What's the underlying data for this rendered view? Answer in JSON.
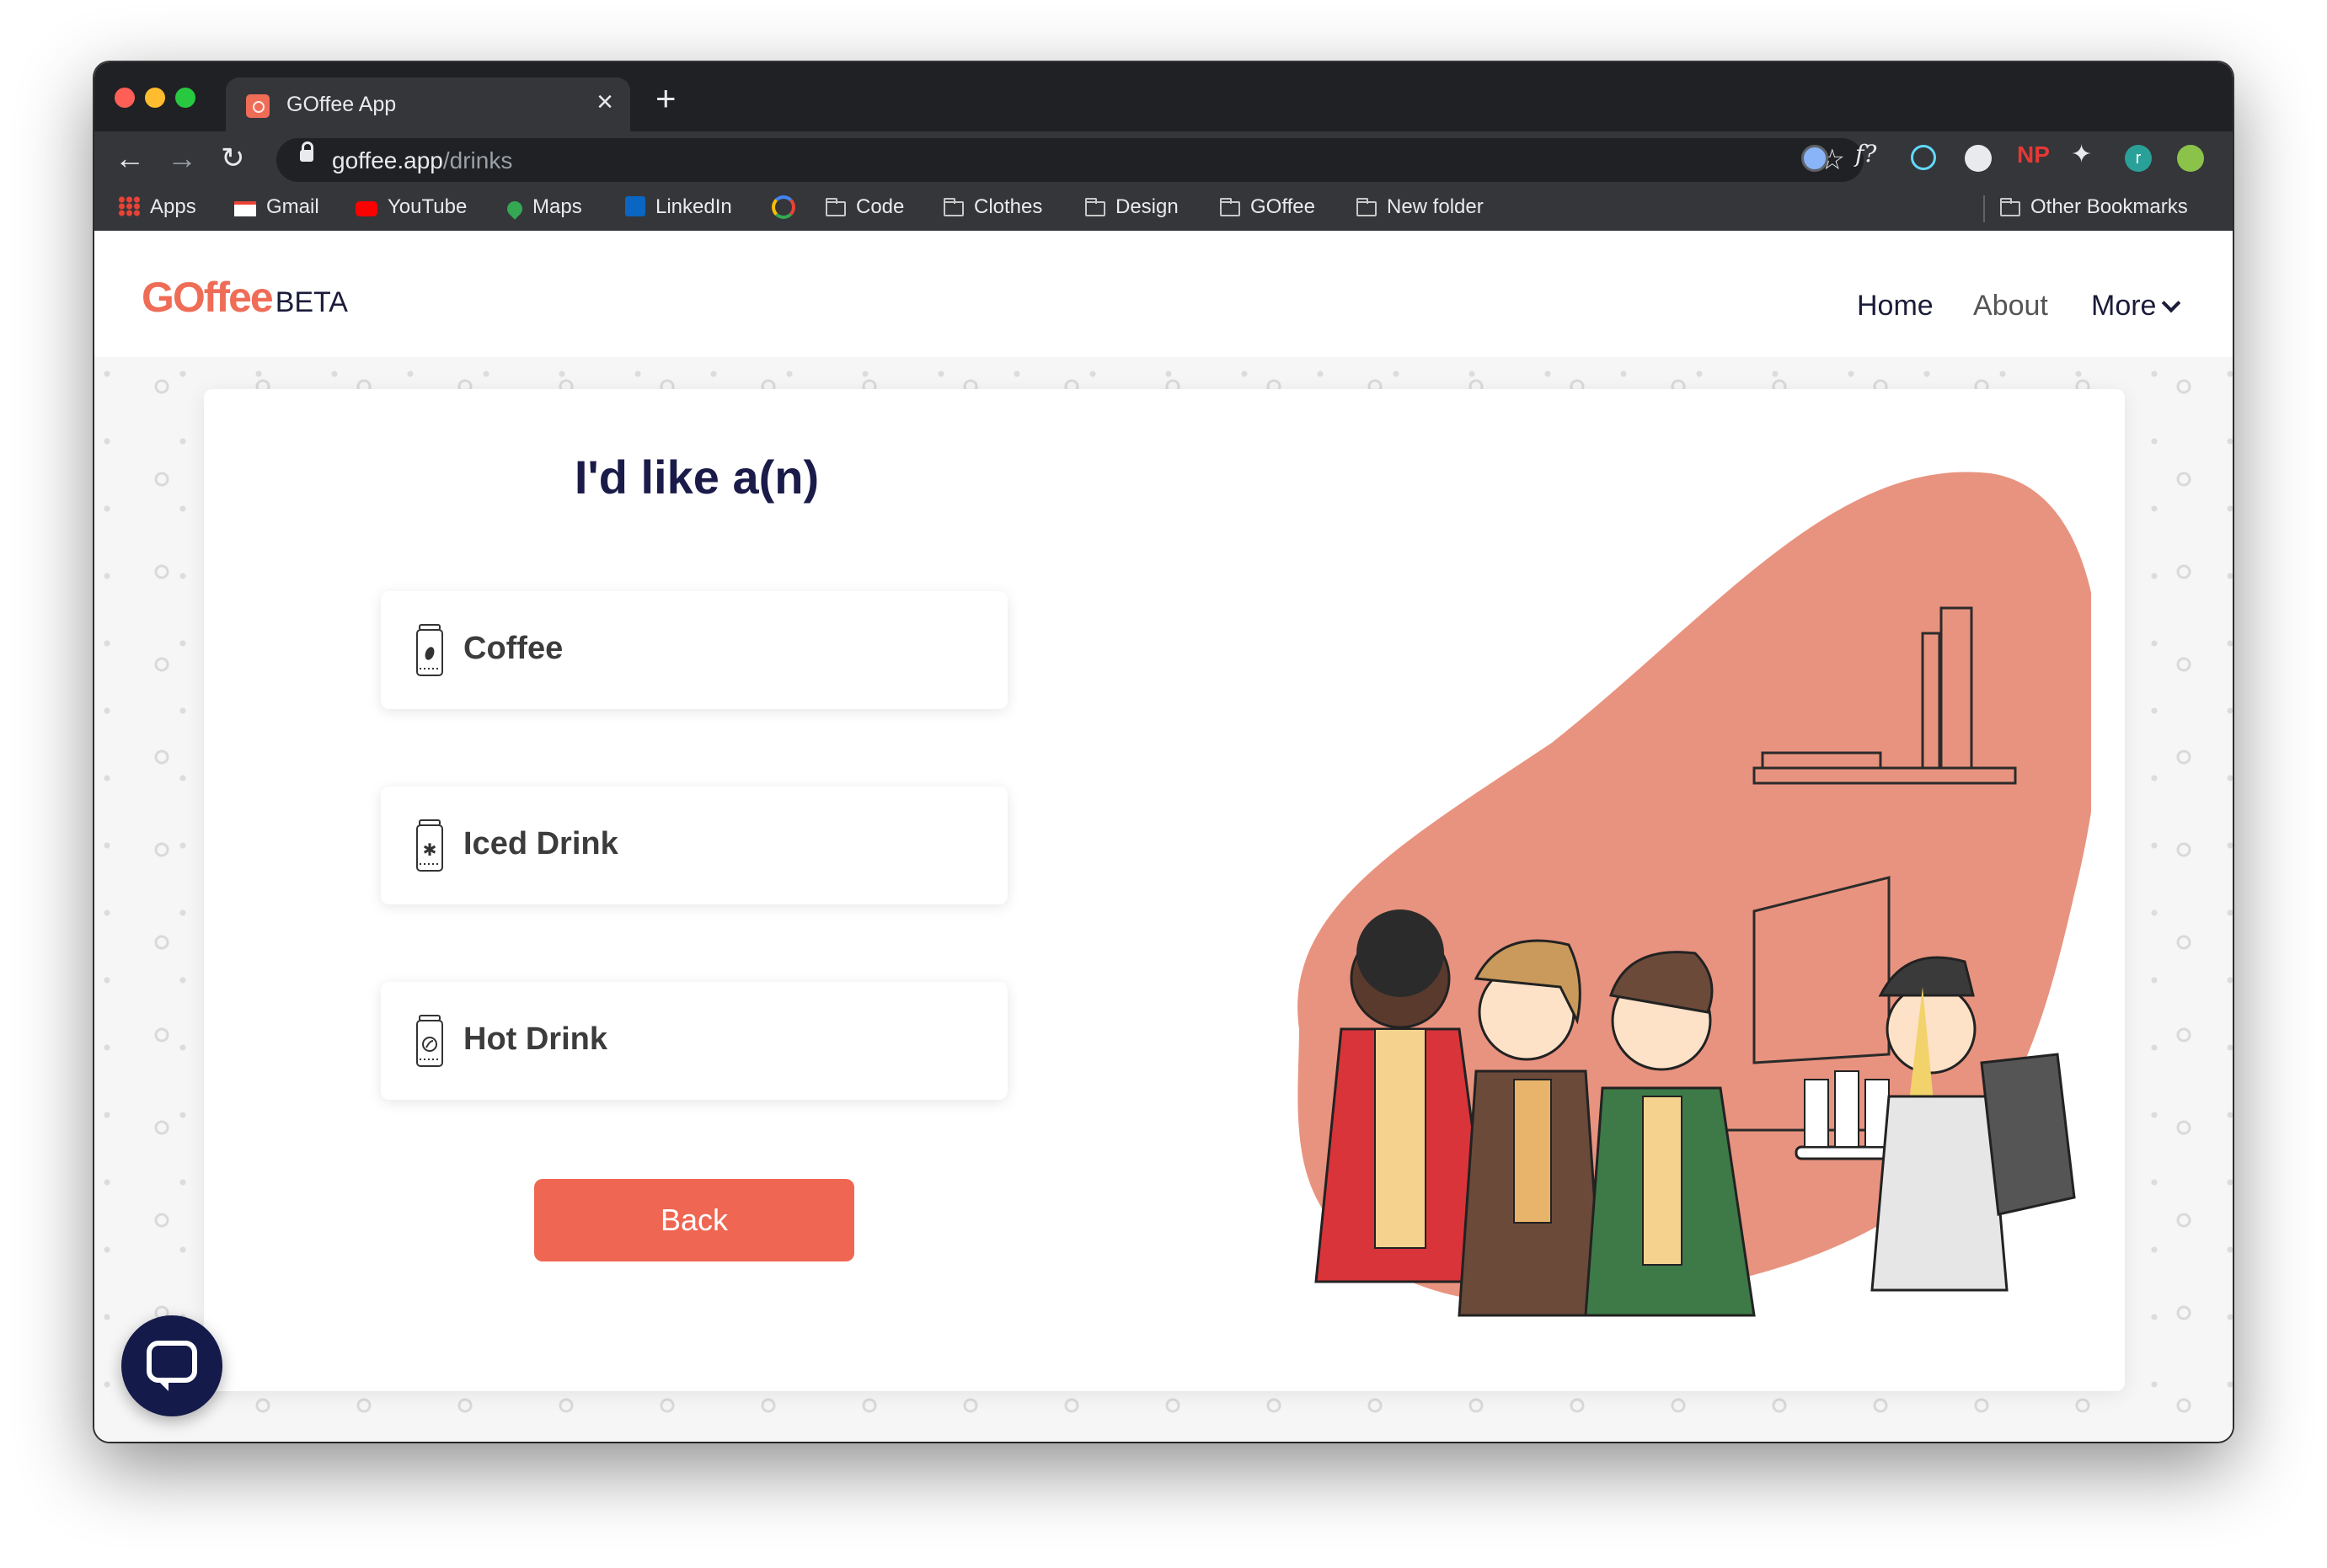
{
  "browser": {
    "tab_title": "GOffee App",
    "url_host": "goffee.app",
    "url_path": "/drinks",
    "bookmarks": [
      {
        "label": "Apps",
        "icon": "apps-grid-icon"
      },
      {
        "label": "Gmail",
        "icon": "gmail-icon"
      },
      {
        "label": "YouTube",
        "icon": "youtube-icon"
      },
      {
        "label": "Maps",
        "icon": "maps-pin-icon"
      },
      {
        "label": "LinkedIn",
        "icon": "linkedin-icon"
      },
      {
        "label": "",
        "icon": "google-icon"
      },
      {
        "label": "Code",
        "icon": "folder-icon"
      },
      {
        "label": "Clothes",
        "icon": "folder-icon"
      },
      {
        "label": "Design",
        "icon": "folder-icon"
      },
      {
        "label": "GOffee",
        "icon": "folder-icon"
      },
      {
        "label": "New folder",
        "icon": "folder-icon"
      }
    ],
    "other_bookmarks": "Other Bookmarks",
    "profile_initial": "r"
  },
  "site": {
    "logo_main": "GOffee",
    "logo_badge": "BETA",
    "nav": {
      "home": "Home",
      "about": "About",
      "more": "More"
    }
  },
  "page": {
    "heading": "I'd like a(n)",
    "options": [
      {
        "label": "Coffee",
        "icon": "coffee-bean-jar-icon"
      },
      {
        "label": "Iced Drink",
        "icon": "snowflake-jar-icon"
      },
      {
        "label": "Hot Drink",
        "icon": "leaf-jar-icon"
      }
    ],
    "back_label": "Back",
    "illustration": "people-holding-coffee-illustration",
    "colors": {
      "brand": "#ef6c57",
      "blob": "#e8937f",
      "button": "#ef6653",
      "heading": "#1b1b4a",
      "chat": "#141a4a"
    }
  }
}
